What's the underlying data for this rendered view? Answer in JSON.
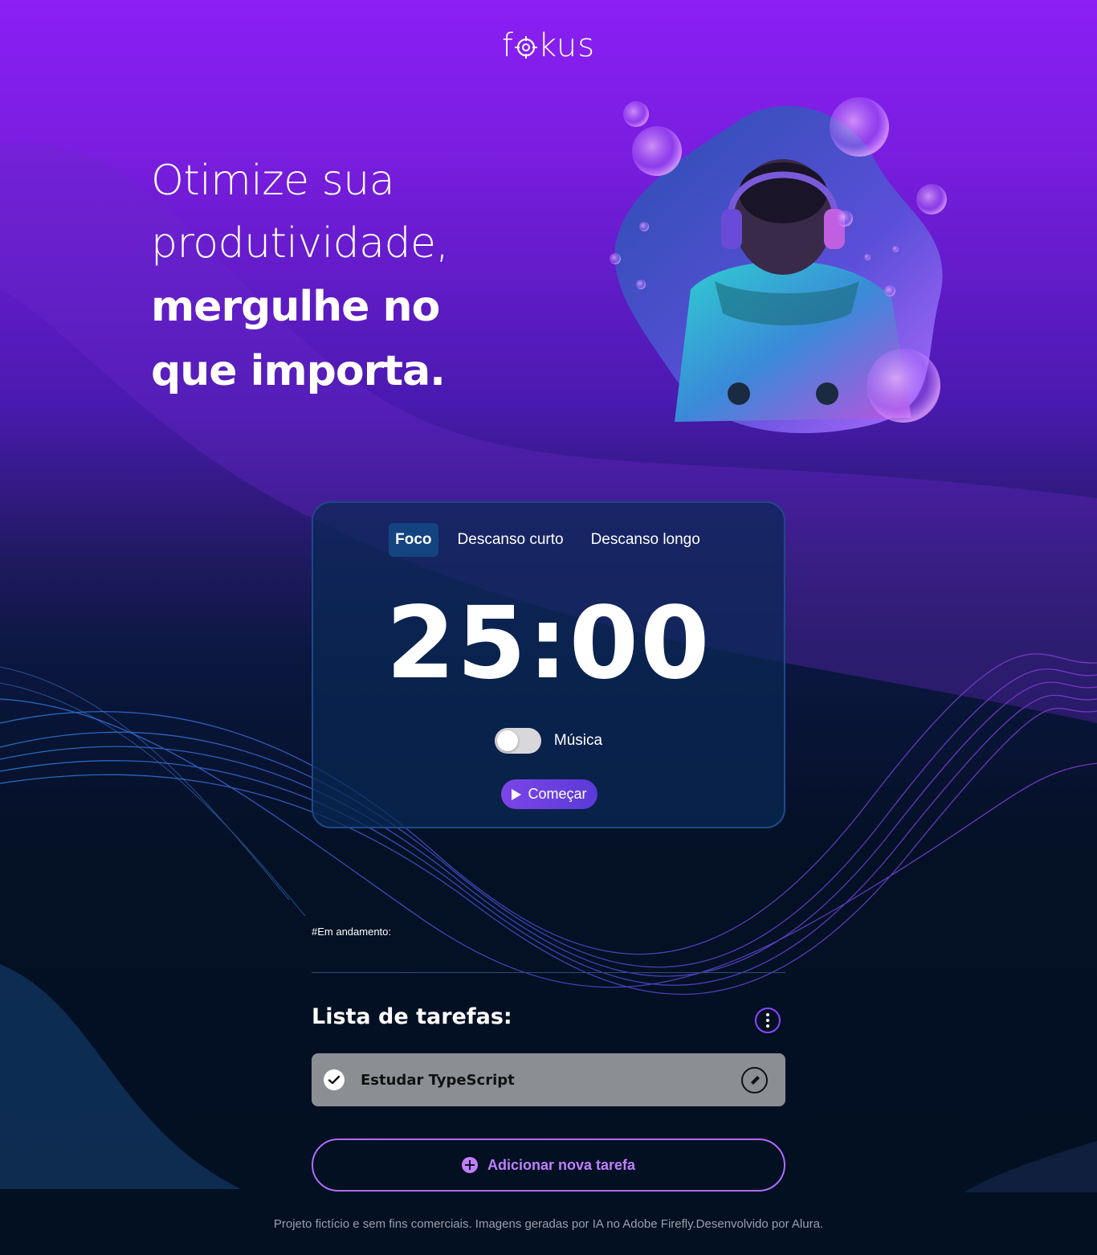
{
  "header": {
    "logo_text_pre": "f",
    "logo_text_post": "kus",
    "logo_icon": "target-icon"
  },
  "hero": {
    "line1": "Otimize sua",
    "line2": "produtividade,",
    "line3": "mergulhe no",
    "line4": "que importa."
  },
  "timer": {
    "tabs": [
      {
        "label": "Foco",
        "active": true
      },
      {
        "label": "Descanso curto",
        "active": false
      },
      {
        "label": "Descanso longo",
        "active": false
      }
    ],
    "time": "25:00",
    "music_label": "Música",
    "music_on": false,
    "start_label": "Começar"
  },
  "tasks": {
    "in_progress_label": "#Em andamento:",
    "title": "Lista de tarefas:",
    "items": [
      {
        "text": "Estudar TypeScript",
        "done": true
      }
    ],
    "add_label": "Adicionar nova tarefa"
  },
  "footer": {
    "text": "Projeto fictício e sem fins comerciais. Imagens geradas por IA no Adobe Firefly.Desenvolvido por Alura."
  },
  "colors": {
    "accent": "#b06cff",
    "card": "#0a2855",
    "active_tab": "#144480"
  }
}
